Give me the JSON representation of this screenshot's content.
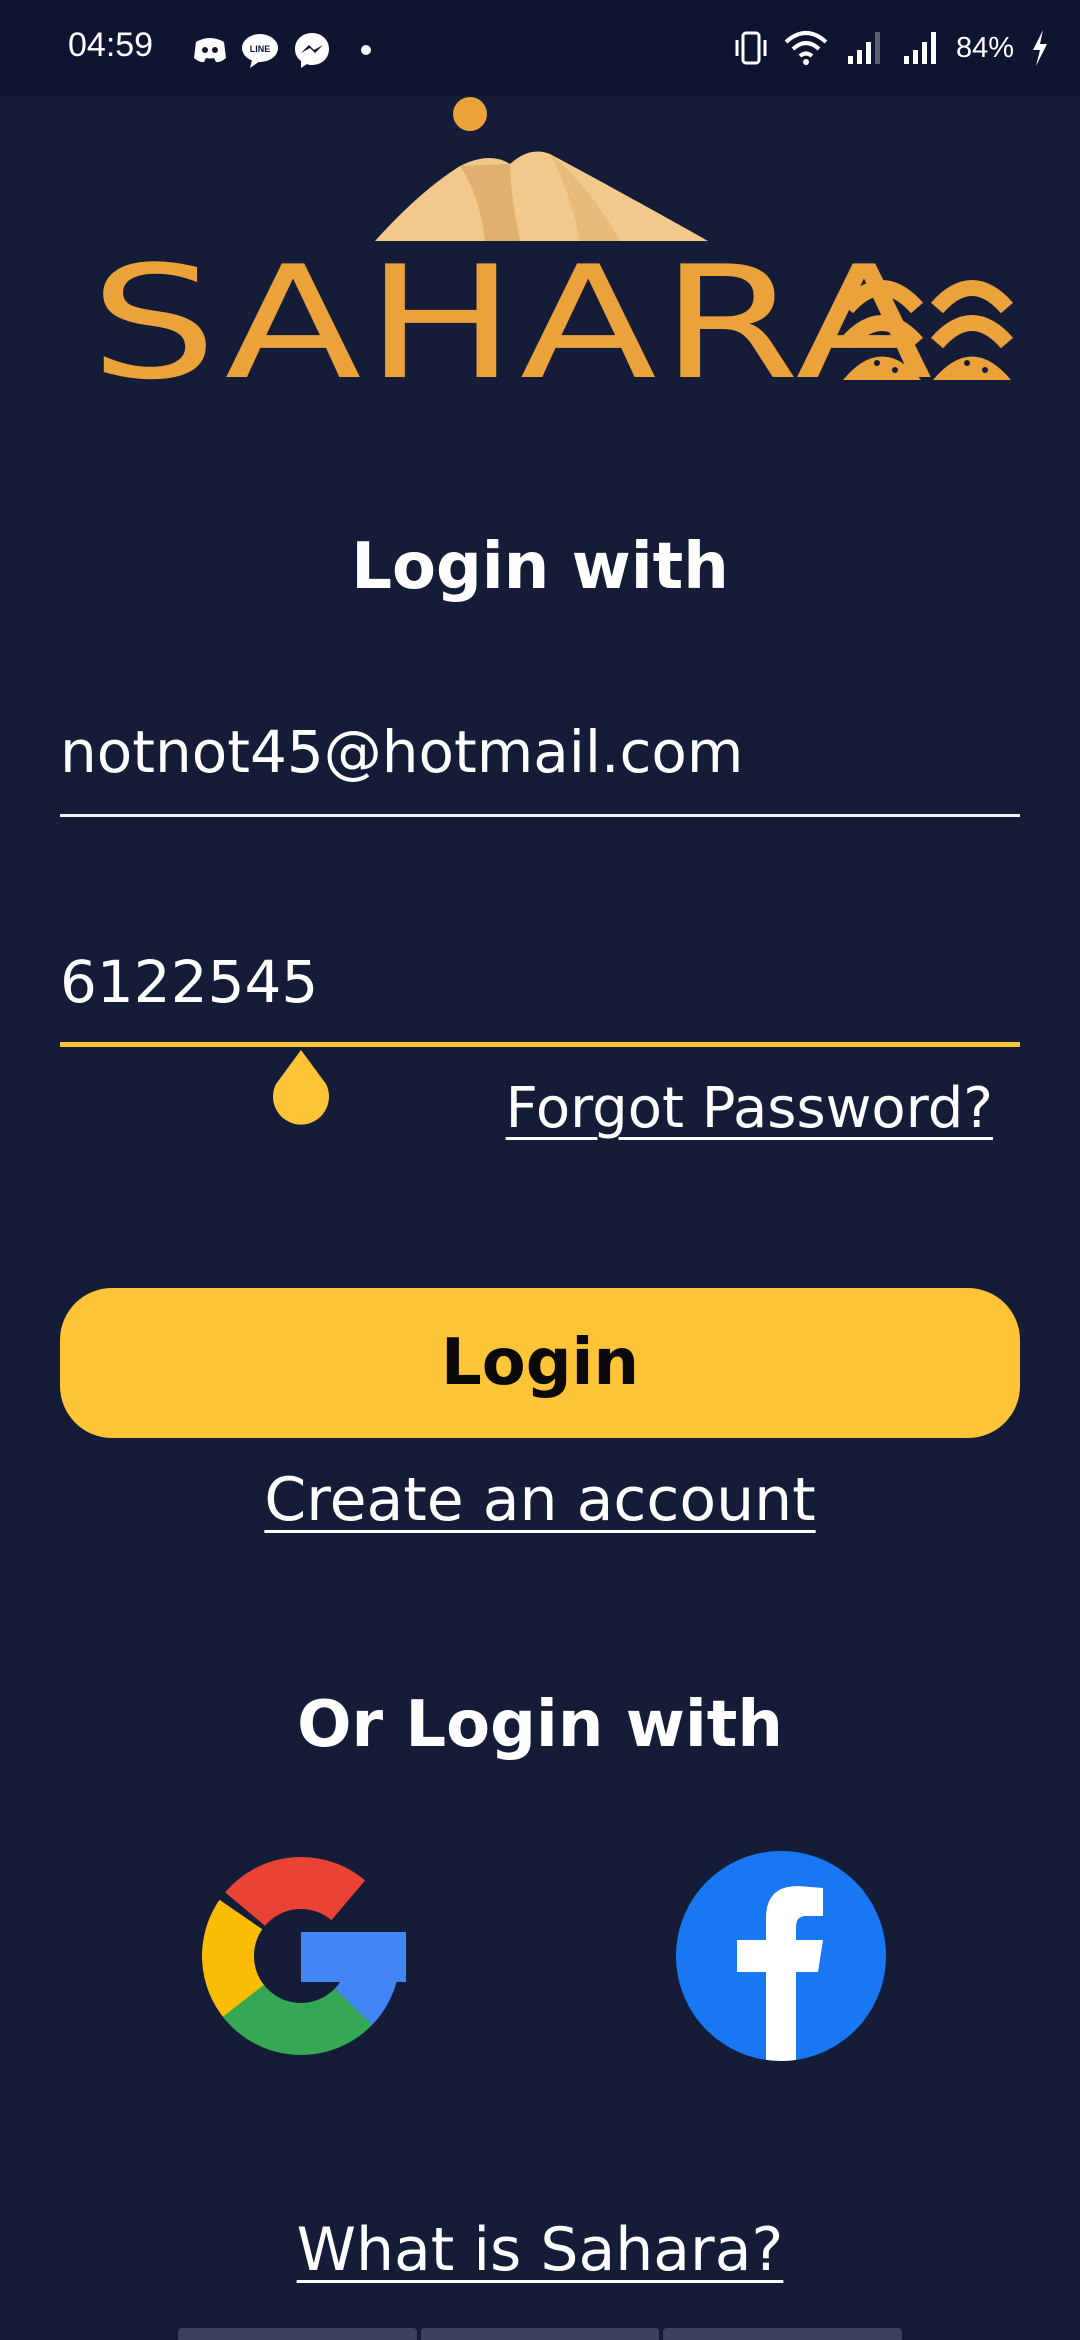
{
  "status_bar": {
    "time": "04:59",
    "battery": "84%",
    "notification_icons": [
      "discord-icon",
      "line-icon",
      "messenger-icon",
      "dot-icon"
    ],
    "system_icons": [
      "vibrate-icon",
      "wifi-icon",
      "signal-icon",
      "signal-icon",
      "charging-icon"
    ]
  },
  "logo": {
    "brand_text": "SAHARA",
    "color": "#eba23a"
  },
  "login_form": {
    "heading": "Login with",
    "email_value": "notnot45@hotmail.com",
    "password_value": "6122545",
    "forgot_password_label": "Forgot Password?",
    "login_button_label": "Login",
    "create_account_label": "Create an account"
  },
  "social_login": {
    "heading": "Or Login with",
    "providers": [
      "google-icon",
      "facebook-icon"
    ]
  },
  "footer": {
    "what_is_label": "What is Sahara?"
  },
  "colors": {
    "background": "#141c38",
    "accent": "#ffc536",
    "status_bar": "#0f1530"
  }
}
